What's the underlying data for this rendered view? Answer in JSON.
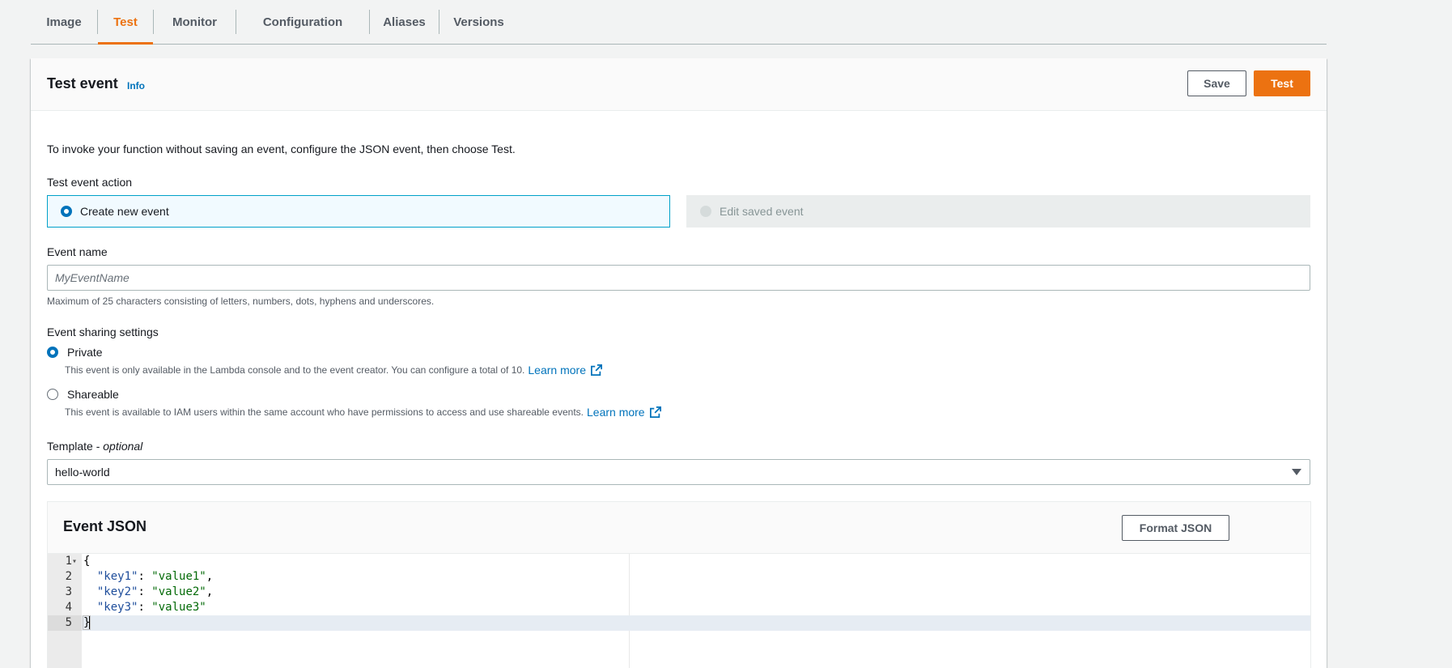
{
  "tabs": [
    {
      "label": "Image"
    },
    {
      "label": "Test"
    },
    {
      "label": "Monitor"
    },
    {
      "label": "Configuration"
    },
    {
      "label": "Aliases"
    },
    {
      "label": "Versions"
    }
  ],
  "active_tab": "Test",
  "panel": {
    "title": "Test event",
    "info": "Info",
    "save_label": "Save",
    "test_label": "Test",
    "description": "To invoke your function without saving an event, configure the JSON event, then choose Test."
  },
  "test_event_action": {
    "label": "Test event action",
    "options": [
      {
        "label": "Create new event",
        "selected": true,
        "disabled": false
      },
      {
        "label": "Edit saved event",
        "selected": false,
        "disabled": true
      }
    ]
  },
  "event_name": {
    "label": "Event name",
    "placeholder": "MyEventName",
    "value": "",
    "hint": "Maximum of 25 characters consisting of letters, numbers, dots, hyphens and underscores."
  },
  "sharing": {
    "label": "Event sharing settings",
    "options": [
      {
        "label": "Private",
        "selected": true,
        "description": "This event is only available in the Lambda console and to the event creator. You can configure a total of 10.",
        "link": "Learn more"
      },
      {
        "label": "Shareable",
        "selected": false,
        "description": "This event is available to IAM users within the same account who have permissions to access and use shareable events.",
        "link": "Learn more"
      }
    ]
  },
  "template": {
    "label": "Template - ",
    "label_optional": "optional",
    "selected": "hello-world"
  },
  "event_json": {
    "title": "Event JSON",
    "format_label": "Format JSON",
    "lines": [
      {
        "n": "1",
        "text": "{"
      },
      {
        "n": "2",
        "key": "\"key1\"",
        "sep": ": ",
        "value": "\"value1\"",
        "end": ","
      },
      {
        "n": "3",
        "key": "\"key2\"",
        "sep": ": ",
        "value": "\"value2\"",
        "end": ","
      },
      {
        "n": "4",
        "key": "\"key3\"",
        "sep": ": ",
        "value": "\"value3\"",
        "end": ""
      },
      {
        "n": "5",
        "text": "}"
      }
    ]
  },
  "colors": {
    "accent": "#ec7211",
    "link": "#0073bb",
    "selected_tile_bg": "#f1faff",
    "selected_tile_border": "#00a1c9"
  }
}
